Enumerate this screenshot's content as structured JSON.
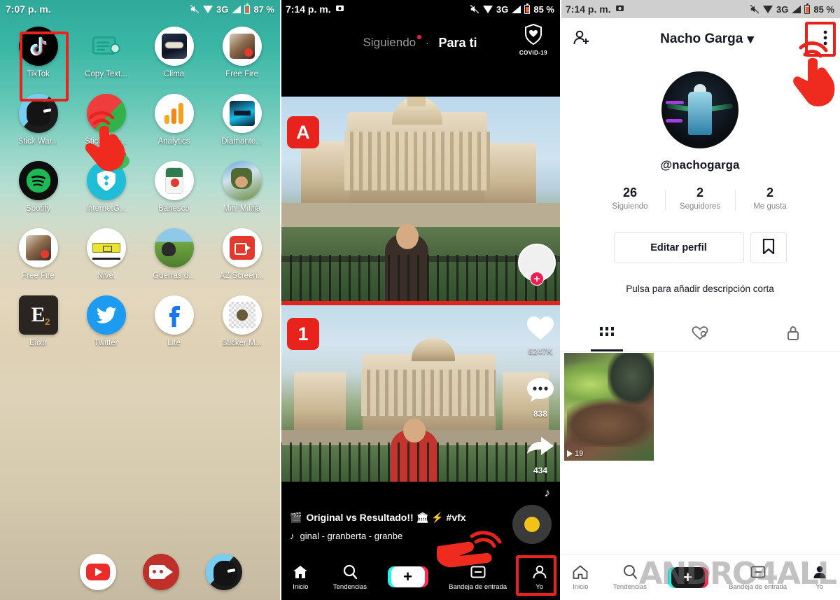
{
  "home": {
    "status": {
      "time": "7:07 p. m.",
      "network": "3G",
      "battery": "87 %",
      "mute_icon": "mute-icon",
      "wifi_icon": "wifi-icon",
      "signal_icon": "signal-icon",
      "battery_icon": "battery-icon"
    },
    "apps": [
      {
        "label": "TikTok",
        "icon": "tiktok-icon"
      },
      {
        "label": "Copy Text...",
        "icon": "copy-text-icon"
      },
      {
        "label": "Clima",
        "icon": "clima-icon"
      },
      {
        "label": "Free Fire",
        "icon": "free-fire-icon"
      },
      {
        "label": "Stick War...",
        "icon": "stick-war-icon"
      },
      {
        "label": "StickerMa...",
        "icon": "sticker-maker-icon"
      },
      {
        "label": "Analytics",
        "icon": "analytics-icon"
      },
      {
        "label": "Diamante...",
        "icon": "diamante-icon"
      },
      {
        "label": "Spotify",
        "icon": "spotify-icon"
      },
      {
        "label": "InternetG...",
        "icon": "internet-guard-icon"
      },
      {
        "label": "Banesco",
        "icon": "banesco-icon"
      },
      {
        "label": "Mini Militia",
        "icon": "mini-militia-icon"
      },
      {
        "label": "Free Fire",
        "icon": "free-fire-icon"
      },
      {
        "label": "Nivel",
        "icon": "nivel-icon"
      },
      {
        "label": "Guerras d...",
        "icon": "guerras-icon"
      },
      {
        "label": "AZ Screen...",
        "icon": "az-screen-icon"
      },
      {
        "label": "Elixir",
        "icon": "elixir-icon"
      },
      {
        "label": "Twitter",
        "icon": "twitter-icon"
      },
      {
        "label": "Lite",
        "icon": "facebook-lite-icon"
      },
      {
        "label": "Sticker M...",
        "icon": "sticker-maker-2-icon"
      }
    ],
    "dock": [
      {
        "label": "YouTube",
        "icon": "youtube-icon"
      },
      {
        "label": "Grabadora",
        "icon": "screen-recorder-icon"
      },
      {
        "label": "Stick War",
        "icon": "stick-war-icon"
      }
    ]
  },
  "feed": {
    "status": {
      "time": "7:14 p. m.",
      "network": "3G",
      "battery": "85 %"
    },
    "tab_following": "Siguiendo",
    "tab_separator": "·",
    "tab_foryou": "Para ti",
    "covid_label": "COVID-19",
    "video_badge_top": "A",
    "video_badge_bottom": "1",
    "likes": "6247K",
    "comments": "838",
    "shares": "434",
    "caption": "Original vs Resultado!! 🏛 ⚡ #vfx",
    "music": "ginal - granberta - granbe",
    "nav": [
      {
        "label": "Inicio",
        "icon": "home-icon"
      },
      {
        "label": "Tendencias",
        "icon": "search-icon"
      },
      {
        "label": "",
        "icon": "add-video-icon"
      },
      {
        "label": "Bandeja de entrada",
        "icon": "inbox-icon"
      },
      {
        "label": "Yo",
        "icon": "profile-icon"
      }
    ]
  },
  "profile": {
    "status": {
      "time": "7:14 p. m.",
      "network": "3G",
      "battery": "85 %"
    },
    "title": "Nacho Garga",
    "title_caret": "▾",
    "add_friend_icon": "add-person-icon",
    "more_icon": "more-options-icon",
    "handle": "@nachogarga",
    "stats": [
      {
        "value": "26",
        "label": "Siguiendo"
      },
      {
        "value": "2",
        "label": "Seguidores"
      },
      {
        "value": "2",
        "label": "Me gusta"
      }
    ],
    "edit_button": "Editar perfil",
    "bookmark_icon": "bookmark-icon",
    "bio_placeholder": "Pulsa para añadir descripción corta",
    "tabs": [
      {
        "icon": "grid-icon",
        "active": true
      },
      {
        "icon": "liked-heart-icon",
        "active": false
      },
      {
        "icon": "lock-icon",
        "active": false
      }
    ],
    "videos": [
      {
        "plays": "19"
      }
    ],
    "nav": [
      {
        "label": "Inicio",
        "icon": "home-icon"
      },
      {
        "label": "Tendencias",
        "icon": "search-icon"
      },
      {
        "label": "",
        "icon": "add-video-icon"
      },
      {
        "label": "Bandeja de entrada",
        "icon": "inbox-icon"
      },
      {
        "label": "Yo",
        "icon": "profile-icon"
      }
    ],
    "watermark": "ANDRO4ALL"
  },
  "annotations": {
    "highlight_color": "#e8231d",
    "boxes": [
      "tiktok-app-highlight",
      "yo-tab-highlight",
      "more-options-highlight"
    ],
    "cursors": [
      "tap-cursor-home",
      "tap-cursor-feed",
      "tap-cursor-profile"
    ]
  }
}
